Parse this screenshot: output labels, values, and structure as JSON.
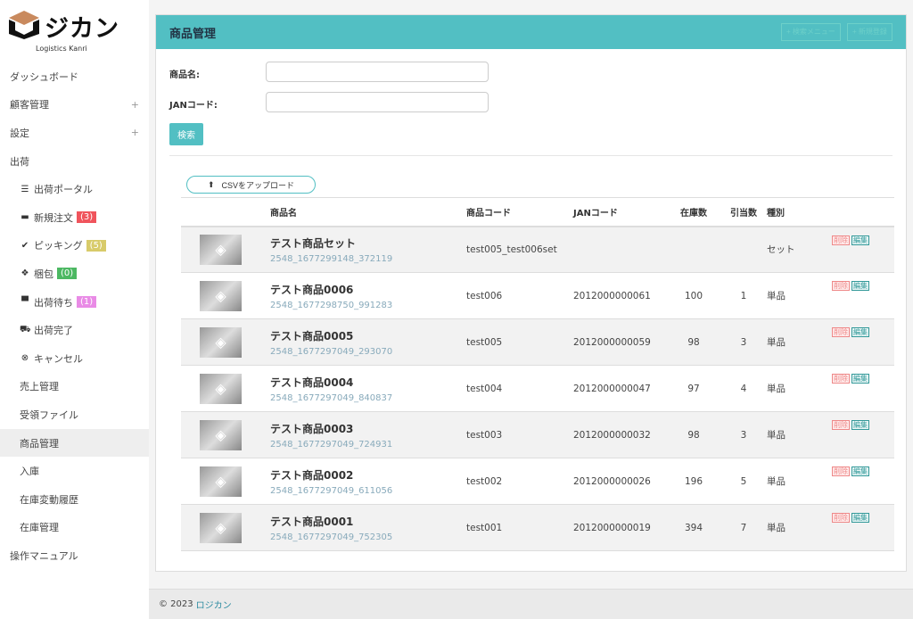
{
  "brand": {
    "name": "ジカン",
    "subtitle": "Logistics Kanri"
  },
  "sidebar": {
    "items": [
      {
        "label": "ダッシュボード"
      },
      {
        "label": "顧客管理",
        "plus": "+"
      },
      {
        "label": "設定",
        "plus": "+"
      },
      {
        "label": "出荷"
      },
      {
        "label": "出荷ポータル",
        "icon": "☰"
      },
      {
        "label": "新規注文",
        "icon": "▬",
        "badge": "(3)",
        "color": "#f0545c"
      },
      {
        "label": "ピッキング",
        "icon": "✔",
        "badge": "(5)",
        "color": "#d8cb6a"
      },
      {
        "label": "梱包",
        "icon": "❖",
        "badge": "(0)",
        "color": "#4cb862"
      },
      {
        "label": "出荷待ち",
        "icon": "▀",
        "badge": "(1)",
        "color": "#e98be6"
      },
      {
        "label": "出荷完了",
        "icon": "⛟"
      },
      {
        "label": "キャンセル",
        "icon": "⊗"
      },
      {
        "label": "売上管理"
      },
      {
        "label": "受領ファイル"
      },
      {
        "label": "商品管理"
      },
      {
        "label": "入庫"
      },
      {
        "label": "在庫変動履歴"
      },
      {
        "label": "在庫管理"
      },
      {
        "label": "操作マニュアル"
      }
    ]
  },
  "card": {
    "title": "商品管理",
    "search_menu": "+ 検索メニュー",
    "new": "+ 新規登録"
  },
  "form": {
    "name_label": "商品名:",
    "jan_label": "JANコード:",
    "search": "検索",
    "csv": "CSVをアップロード"
  },
  "table": {
    "headers": [
      "商品名",
      "商品コード",
      "JANコード",
      "在庫数",
      "引当数",
      "種別"
    ],
    "delete": "削除",
    "edit": "編集",
    "rows": [
      {
        "name": "テスト商品セット",
        "id": "2548_1677299148_372119",
        "code": "test005_test006set",
        "jan": "",
        "stock": "",
        "alloc": "",
        "type": "セット"
      },
      {
        "name": "テスト商品0006",
        "id": "2548_1677298750_991283",
        "code": "test006",
        "jan": "2012000000061",
        "stock": "100",
        "alloc": "1",
        "type": "単品"
      },
      {
        "name": "テスト商品0005",
        "id": "2548_1677297049_293070",
        "code": "test005",
        "jan": "2012000000059",
        "stock": "98",
        "alloc": "3",
        "type": "単品"
      },
      {
        "name": "テスト商品0004",
        "id": "2548_1677297049_840837",
        "code": "test004",
        "jan": "2012000000047",
        "stock": "97",
        "alloc": "4",
        "type": "単品"
      },
      {
        "name": "テスト商品0003",
        "id": "2548_1677297049_724931",
        "code": "test003",
        "jan": "2012000000032",
        "stock": "98",
        "alloc": "3",
        "type": "単品"
      },
      {
        "name": "テスト商品0002",
        "id": "2548_1677297049_611056",
        "code": "test002",
        "jan": "2012000000026",
        "stock": "196",
        "alloc": "5",
        "type": "単品"
      },
      {
        "name": "テスト商品0001",
        "id": "2548_1677297049_752305",
        "code": "test001",
        "jan": "2012000000019",
        "stock": "394",
        "alloc": "7",
        "type": "単品"
      }
    ]
  },
  "footer": {
    "copy": "© 2023",
    "link": "ロジカン"
  }
}
